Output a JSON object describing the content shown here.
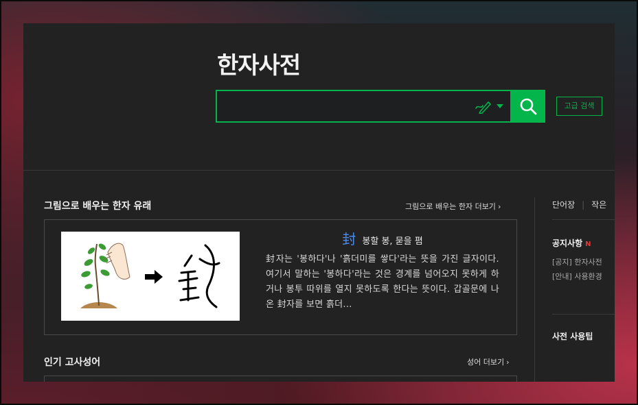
{
  "header": {
    "title": "한자사전",
    "search": {
      "value": "",
      "placeholder": ""
    },
    "advanced_search_label": "고급 검색"
  },
  "section_picture": {
    "title": "그림으로 배우는 한자 유래",
    "more_label": "그림으로 배우는 한자 더보기",
    "hanja": "封",
    "meaning": "봉할 봉, 묻을 폄",
    "description": "封자는 '봉하다'나 '흙더미를 쌓다'라는 뜻을 가진 글자이다. 여기서 말하는 '봉하다'라는 것은 경계를 넘어오지 못하게 하거나 봉투 따위를 열지 못하도록 한다는 뜻이다. 갑골문에 나온 封자를 보면 흙더..."
  },
  "section_idiom": {
    "title": "인기 고사성어",
    "more_label": "성어 더보기"
  },
  "sidebar": {
    "tabs": [
      "단어장",
      "작은"
    ],
    "notice": {
      "title": "공지사항",
      "badge": "N",
      "items": [
        "[공지] 한자사전",
        "[안내] 사용환경"
      ]
    },
    "tips_title": "사전 사용팁"
  },
  "colors": {
    "accent": "#03b54a",
    "panel_bg": "#222223",
    "hanja": "#4a8cf0",
    "badge": "#e23a3a"
  },
  "icons": {
    "handwriting": "pen-icon",
    "search": "search-icon",
    "chevron": "chevron-right-icon"
  }
}
